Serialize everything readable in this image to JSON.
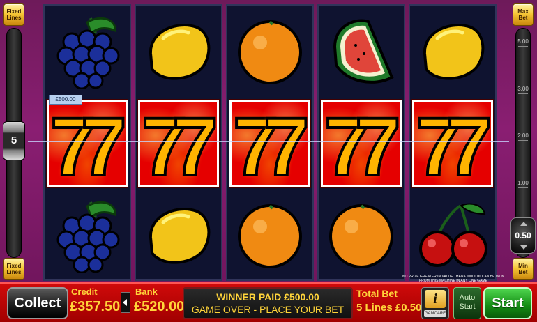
{
  "left_rail": {
    "fixed_lines_top": "Fixed Lines",
    "fixed_lines_bottom": "Fixed Lines",
    "lines_value": "5"
  },
  "right_rail": {
    "max_bet": "Max Bet",
    "min_bet": "Min Bet",
    "scale": [
      "5.00",
      "3.00",
      "2.00",
      "1.00"
    ],
    "bet_value": "0.50"
  },
  "reels": [
    {
      "top": "grapes",
      "middle": "seven",
      "bottom": "grapes"
    },
    {
      "top": "lemon",
      "middle": "seven",
      "bottom": "lemon"
    },
    {
      "top": "orange",
      "middle": "seven",
      "bottom": "orange"
    },
    {
      "top": "watermelon",
      "middle": "seven",
      "bottom": "orange"
    },
    {
      "top": "lemon",
      "middle": "seven",
      "bottom": "cherries"
    }
  ],
  "win_tag": "£500.00",
  "disclaimer": "NO PRIZE GREATER IN VALUE THAN £10000.00 CAN BE WON FROM THIS MACHINE IN ANY ONE GAME",
  "bottom": {
    "collect": "Collect",
    "credit_label": "Credit",
    "credit_value": "£357.50",
    "bank_label": "Bank",
    "bank_value": "£520.00",
    "message_1": "WINNER PAID £500.00",
    "message_2": "GAME OVER - PLACE YOUR BET",
    "total_bet_label": "Total Bet",
    "total_bet_value": "5 Lines £0.50",
    "info": "i",
    "gamcare": "GAMCARE",
    "auto_start": "Auto Start",
    "start": "Start"
  },
  "colors": {
    "background": "#8a1e72",
    "win_cell": "#e50000",
    "bar": "#c40000",
    "label_gold": "#ffd43a",
    "start_green": "#1fa81f"
  }
}
